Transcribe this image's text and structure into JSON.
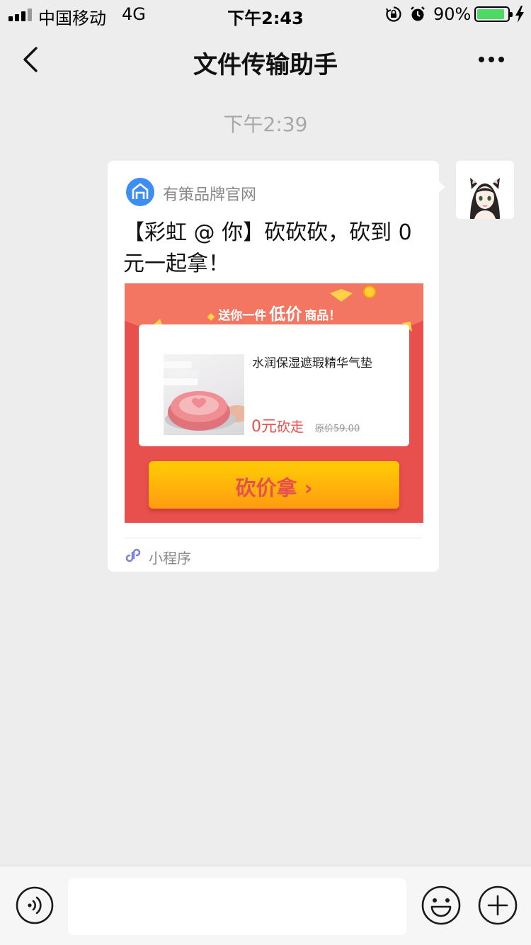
{
  "status_bar": {
    "carrier": "中国移动",
    "network": "4G",
    "time": "下午2:43",
    "battery_pct": "90%",
    "battery_level": 0.9,
    "battery_color": "#4cd964"
  },
  "nav": {
    "title": "文件传输助手"
  },
  "chat": {
    "timestamp": "下午2:39"
  },
  "card": {
    "brand_name": "有策品牌官网",
    "title": "【彩虹 @ 你】砍砍砍，砍到 0 元一起拿！",
    "banner_pre": "送你一件",
    "banner_big": "低价",
    "banner_post": "商品！",
    "product_name": "水润保湿遮瑕精华气垫",
    "price_zero": "0元",
    "price_suffix": "砍走",
    "original_price": "原价59.00",
    "cta_label": "砍价拿",
    "footer_label": "小程序",
    "accent_color": "#e8504d",
    "cta_color": "#ffb30a"
  },
  "input": {
    "placeholder": ""
  }
}
